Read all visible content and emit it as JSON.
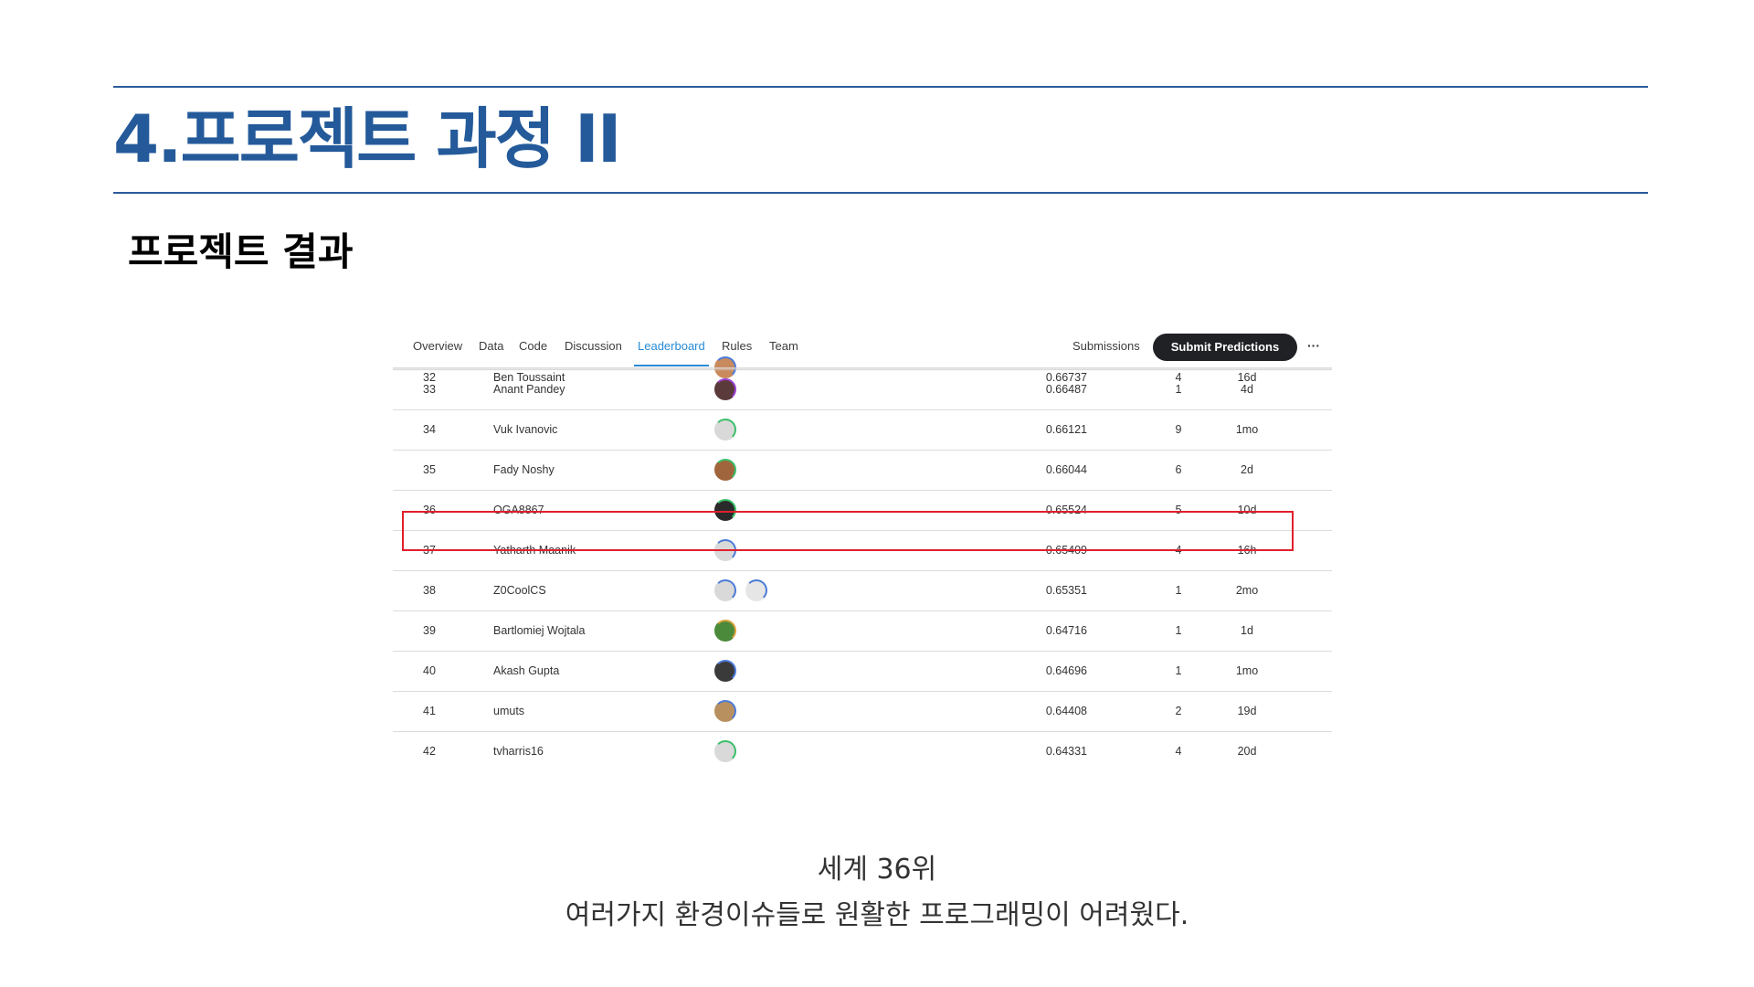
{
  "slide": {
    "title": "4.프로젝트 과정 II",
    "subtitle": "프로젝트 결과",
    "caption_line1": "세계 36위",
    "caption_line2": "여러가지 환경이슈들로 원활한 프로그래밍이 어려웠다.",
    "accent_color": "#245a9a"
  },
  "leaderboard": {
    "tabs": [
      {
        "label": "Overview",
        "active": false
      },
      {
        "label": "Data",
        "active": false
      },
      {
        "label": "Code",
        "active": false
      },
      {
        "label": "Discussion",
        "active": false
      },
      {
        "label": "Leaderboard",
        "active": true
      },
      {
        "label": "Rules",
        "active": false
      },
      {
        "label": "Team",
        "active": false
      }
    ],
    "submissions_label": "Submissions",
    "submit_label": "Submit Predictions",
    "more_icon": "···",
    "highlight_color": "#e0202c",
    "highlighted_rank": "36",
    "rows": [
      {
        "rank": "32",
        "name": "Ben Toussaint",
        "score": "0.66737",
        "entries": "4",
        "last": "16d",
        "avatars": [
          {
            "icon": "user-avatar-icon",
            "color": "#c98a5e",
            "ring": "#4c7bd9"
          }
        ]
      },
      {
        "rank": "33",
        "name": "Anant Pandey",
        "score": "0.66487",
        "entries": "1",
        "last": "4d",
        "avatars": [
          {
            "icon": "user-avatar-icon",
            "color": "#5a3a3a",
            "ring": "#9b3fd1"
          }
        ]
      },
      {
        "rank": "34",
        "name": "Vuk Ivanovic",
        "score": "0.66121",
        "entries": "9",
        "last": "1mo",
        "avatars": [
          {
            "icon": "default-avatar-icon",
            "color": "#d9d9d9",
            "ring": "#3bbf6a"
          }
        ]
      },
      {
        "rank": "35",
        "name": "Fady Noshy",
        "score": "0.66044",
        "entries": "6",
        "last": "2d",
        "avatars": [
          {
            "icon": "user-avatar-icon",
            "color": "#a0653c",
            "ring": "#3bbf6a"
          }
        ]
      },
      {
        "rank": "36",
        "name": "OGA8867",
        "score": "0.65524",
        "entries": "5",
        "last": "10d",
        "avatars": [
          {
            "icon": "user-avatar-icon",
            "color": "#2a2a2a",
            "ring": "#3bbf6a"
          }
        ]
      },
      {
        "rank": "37",
        "name": "Yatharth Maanik",
        "score": "0.65409",
        "entries": "4",
        "last": "16h",
        "avatars": [
          {
            "icon": "default-avatar-icon",
            "color": "#d9d9d9",
            "ring": "#4c7bd9"
          }
        ]
      },
      {
        "rank": "38",
        "name": "Z0CoolCS",
        "score": "0.65351",
        "entries": "1",
        "last": "2mo",
        "avatars": [
          {
            "icon": "default-avatar-icon",
            "color": "#d9d9d9",
            "ring": "#4c7bd9"
          },
          {
            "icon": "default-avatar-icon",
            "color": "#e6e6e6",
            "ring": "#4c7bd9"
          }
        ]
      },
      {
        "rank": "39",
        "name": "Bartlomiej Wojtala",
        "score": "0.64716",
        "entries": "1",
        "last": "1d",
        "avatars": [
          {
            "icon": "user-avatar-icon",
            "color": "#4a8a3a",
            "ring": "#d9a13b"
          }
        ]
      },
      {
        "rank": "40",
        "name": "Akash Gupta",
        "score": "0.64696",
        "entries": "1",
        "last": "1mo",
        "avatars": [
          {
            "icon": "user-avatar-icon",
            "color": "#3a3a3a",
            "ring": "#4c7bd9"
          }
        ]
      },
      {
        "rank": "41",
        "name": "umuts",
        "score": "0.64408",
        "entries": "2",
        "last": "19d",
        "avatars": [
          {
            "icon": "user-avatar-icon",
            "color": "#b89060",
            "ring": "#4c7bd9"
          }
        ]
      },
      {
        "rank": "42",
        "name": "tvharris16",
        "score": "0.64331",
        "entries": "4",
        "last": "20d",
        "avatars": [
          {
            "icon": "default-avatar-icon",
            "color": "#d9d9d9",
            "ring": "#3bbf6a"
          }
        ]
      }
    ]
  }
}
